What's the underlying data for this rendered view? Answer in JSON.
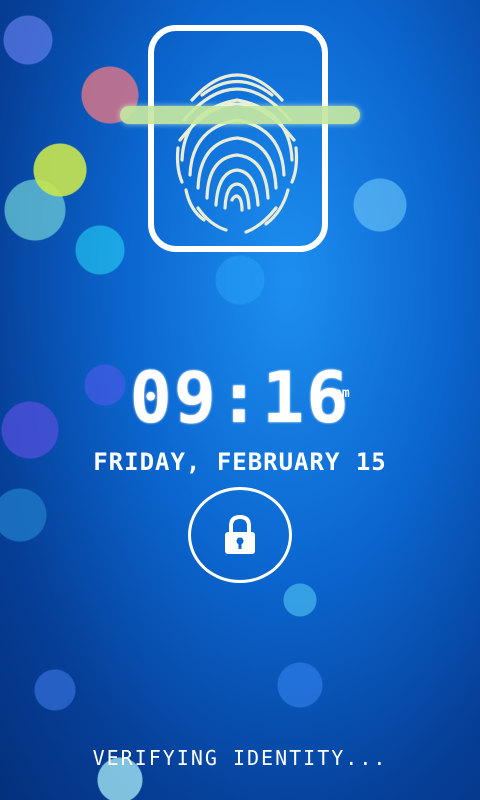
{
  "lockscreen": {
    "time": "09:16",
    "ampm": "pm",
    "date": "FRIDAY, FEBRUARY 15",
    "status": "VERIFYING IDENTITY..."
  },
  "icons": {
    "scanner": "fingerprint-icon",
    "unlock": "padlock-icon"
  },
  "colors": {
    "scan_bar": "#c6e8a2",
    "background": "#0b66cf",
    "foreground": "#ffffff"
  }
}
